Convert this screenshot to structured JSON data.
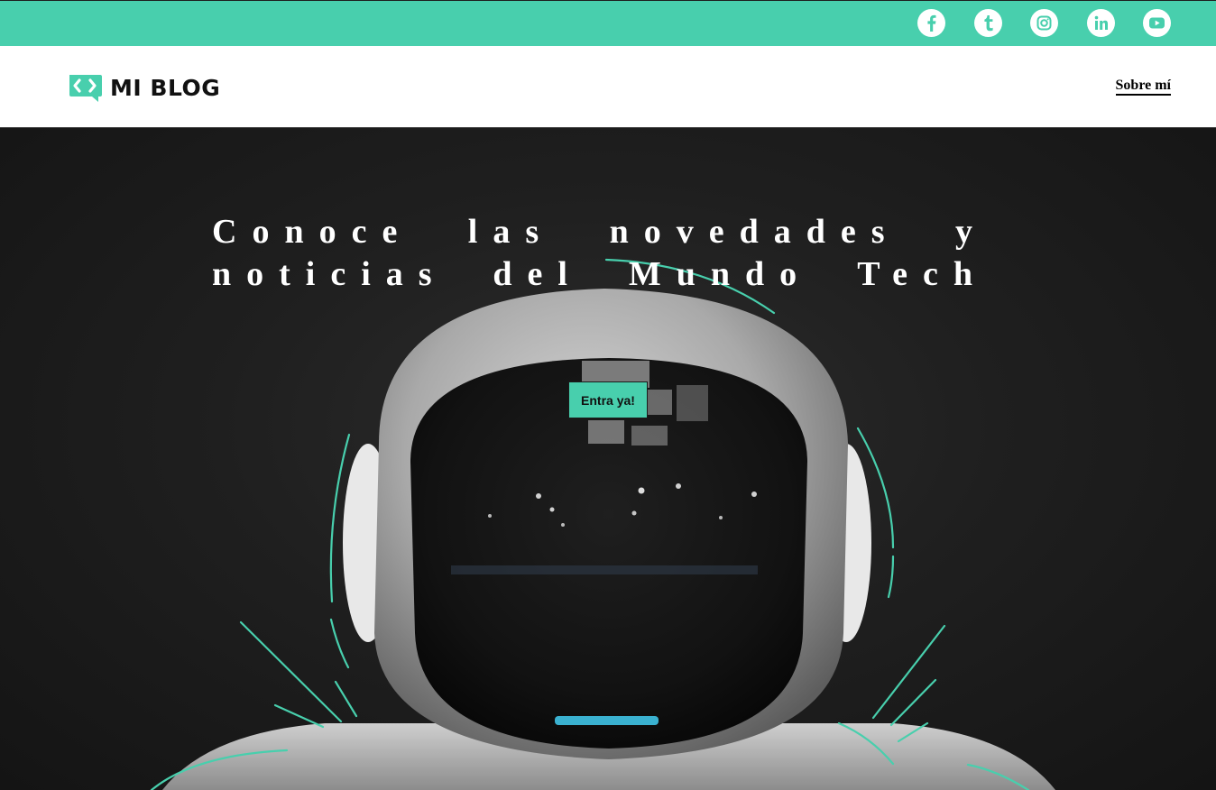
{
  "colors": {
    "accent": "#48cfad",
    "dark": "#1f1f1f",
    "white": "#ffffff"
  },
  "social": [
    {
      "name": "facebook",
      "icon": "facebook-icon"
    },
    {
      "name": "tumblr",
      "icon": "tumblr-icon"
    },
    {
      "name": "instagram",
      "icon": "instagram-icon"
    },
    {
      "name": "linkedin",
      "icon": "linkedin-icon"
    },
    {
      "name": "youtube",
      "icon": "youtube-icon"
    }
  ],
  "header": {
    "logo_icon": "code-chat-icon",
    "logo_text": "MI BLOG",
    "nav_link": "Sobre mí"
  },
  "hero": {
    "title": "Conoce las novedades y noticias del Mundo Tech",
    "cta_label": "Entra ya!",
    "image": "astronaut-robot-helmet"
  }
}
